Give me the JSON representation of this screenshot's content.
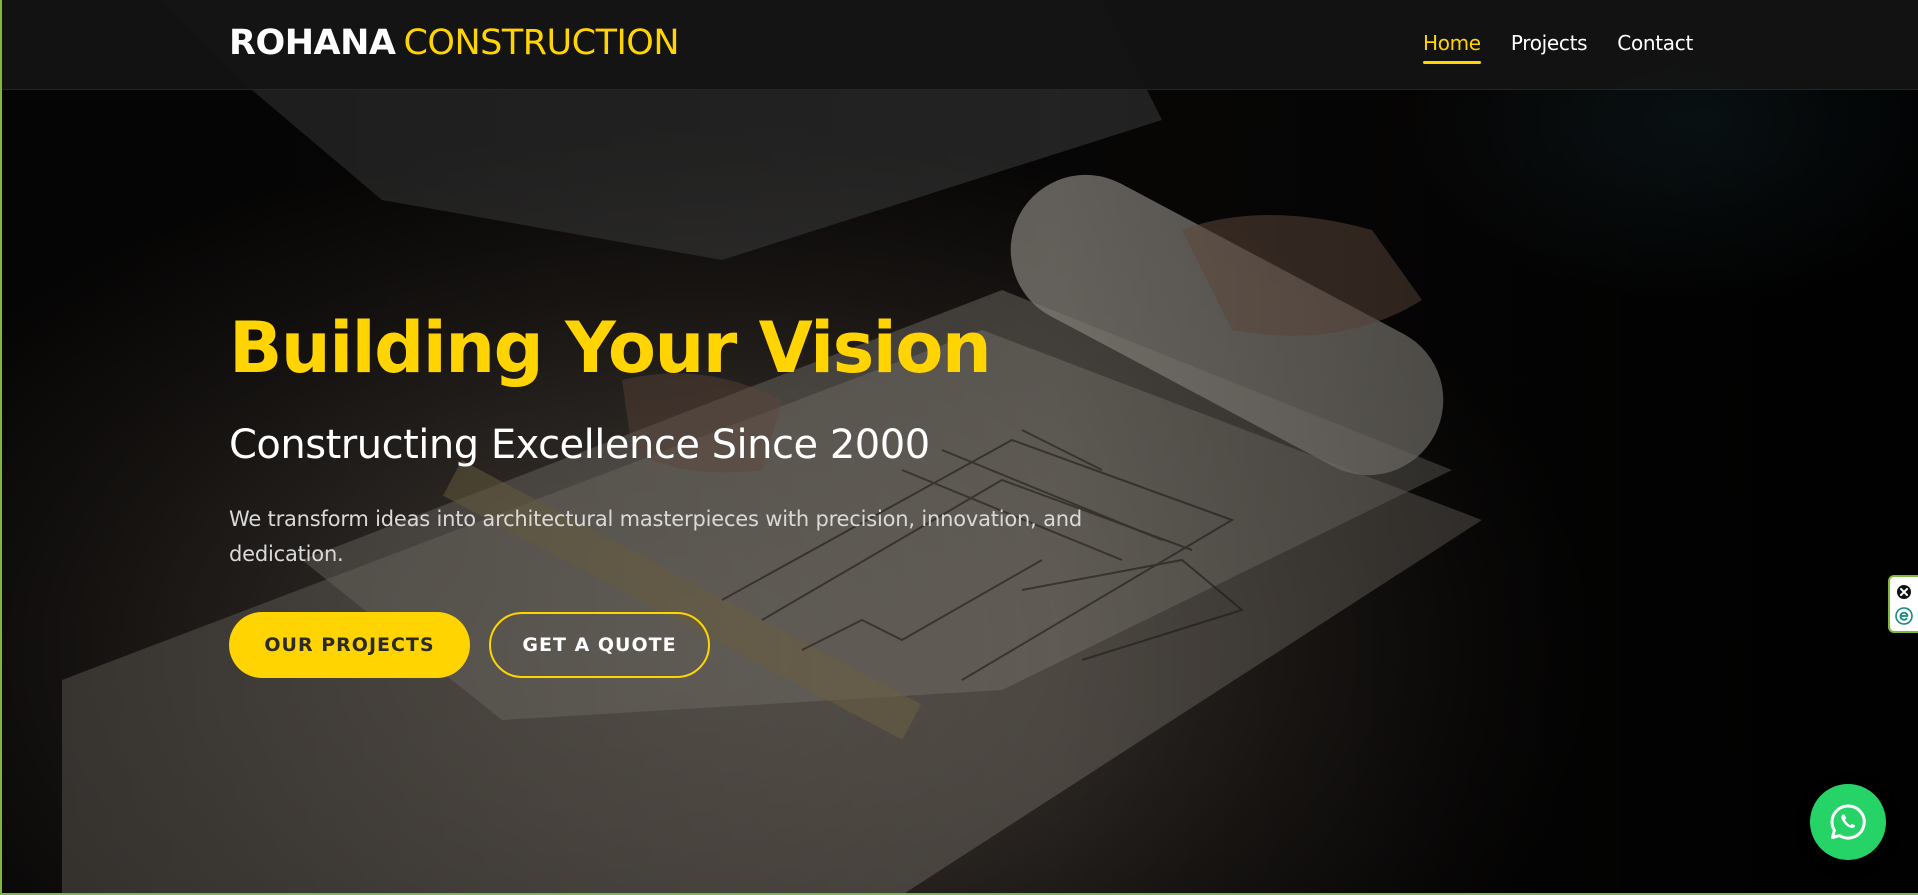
{
  "header": {
    "logo_strong": "ROHANA",
    "logo_light": "CONSTRUCTION",
    "nav": [
      {
        "label": "Home",
        "active": true
      },
      {
        "label": "Projects",
        "active": false
      },
      {
        "label": "Contact",
        "active": false
      }
    ]
  },
  "hero": {
    "title": "Building Your Vision",
    "subtitle": "Constructing Excellence Since 2000",
    "description": "We transform ideas into architectural masterpieces with precision, innovation, and dedication.",
    "primary_button": "OUR PROJECTS",
    "secondary_button": "GET A QUOTE",
    "background_image": "architect-drawing-blueprints"
  },
  "side_widget": {
    "icons": [
      "close-icon",
      "e-icon"
    ]
  },
  "floating": {
    "icon": "whatsapp-icon",
    "color": "#25d366"
  },
  "colors": {
    "accent": "#ffd400",
    "header_bg": "#141414",
    "text_light": "#ffffff"
  }
}
